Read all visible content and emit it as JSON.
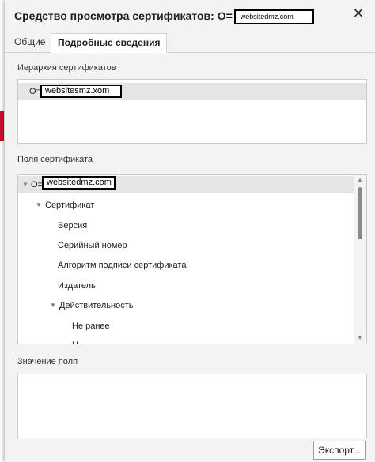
{
  "window": {
    "title": "Средство просмотра сертификатов: O=",
    "title_redacted": "websitedmz.com",
    "close_label": "✕"
  },
  "tabs": [
    {
      "label": "Общие",
      "active": false
    },
    {
      "label": "Подробные сведения",
      "active": true
    }
  ],
  "hierarchy": {
    "label": "Иерархия сертификатов",
    "item_prefix": "O=",
    "item_redacted": "websitesmz.xom"
  },
  "fields": {
    "label": "Поля сертификата",
    "root_prefix": "O=",
    "root_redacted": "websitedmz.com",
    "items": [
      {
        "text": "Сертификат"
      },
      {
        "text": "Версия"
      },
      {
        "text": "Серийный номер"
      },
      {
        "text": "Алгоритм подписи сертификата"
      },
      {
        "text": "Издатель"
      },
      {
        "text": "Действительность"
      },
      {
        "text": "Не ранее"
      },
      {
        "text": "Н"
      }
    ]
  },
  "value": {
    "label": "Значение поля",
    "content": ""
  },
  "actions": {
    "export_label": "Экспорт..."
  },
  "colors": {
    "dialog_bg": "#f3f3f3",
    "selected_row": "#e5e5e5",
    "border": "#c9c9c9"
  }
}
